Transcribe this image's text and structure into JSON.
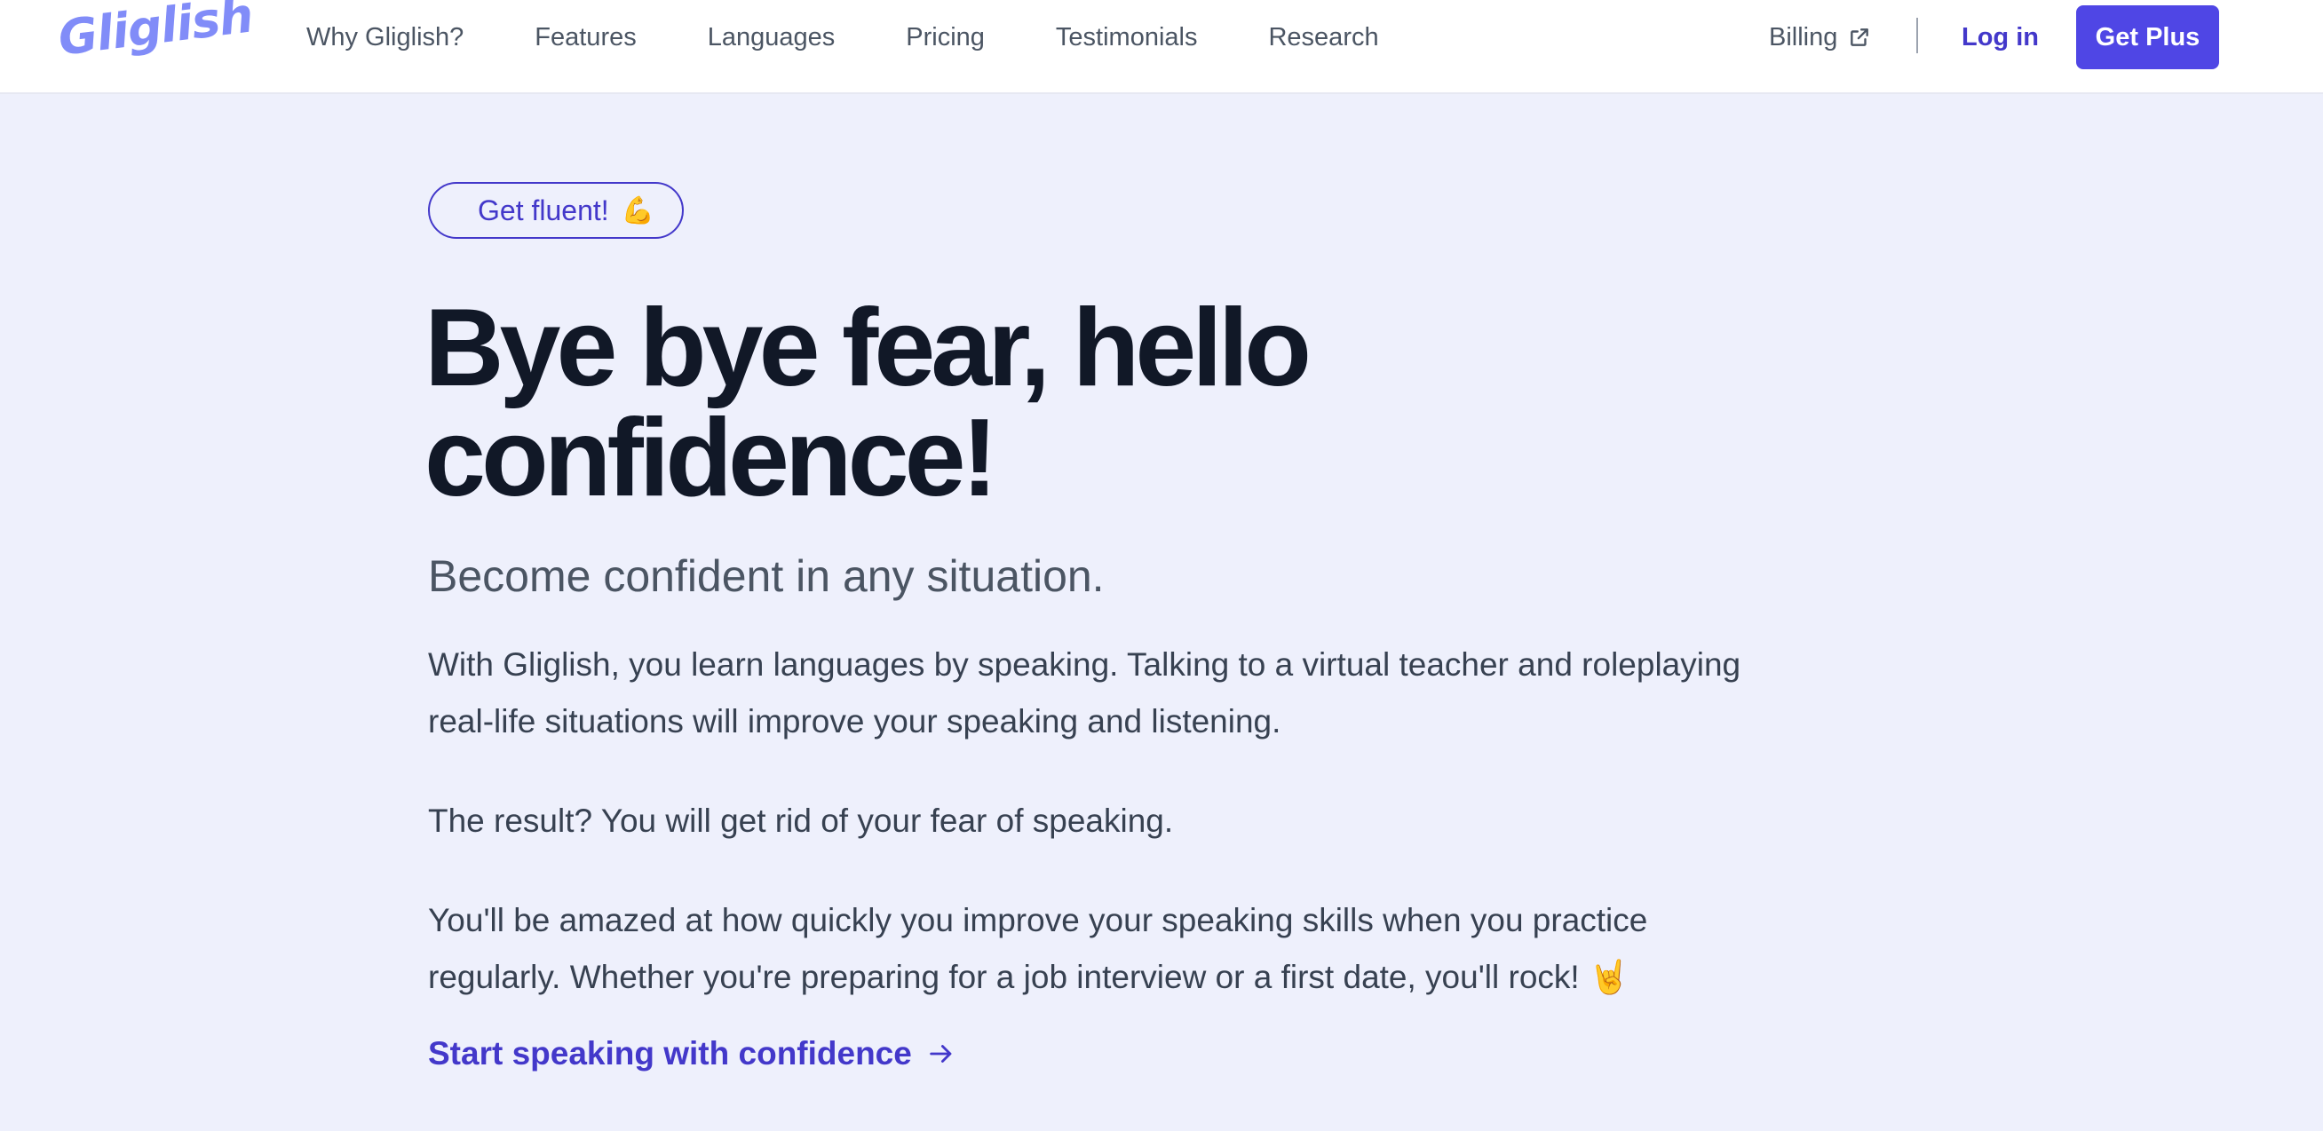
{
  "brand": {
    "logo_text": "Gliglish",
    "accent": "#4f46e5",
    "logo_color": "#818cf8",
    "background": "#eef0fc"
  },
  "nav": {
    "links": [
      "Why Gliglish?",
      "Features",
      "Languages",
      "Pricing",
      "Testimonials",
      "Research"
    ],
    "billing_label": "Billing",
    "billing_icon": "external-link-icon",
    "login_label": "Log in",
    "cta_label": "Get Plus"
  },
  "hero": {
    "pill_label": "Get fluent!",
    "pill_emoji": "💪",
    "headline_line1": "Bye bye fear, hello",
    "headline_line2": "confidence!",
    "subtitle": "Become confident in any situation.",
    "paragraph1": "With Gliglish, you learn languages by speaking. Talking to a virtual teacher and roleplaying real-life situations will improve your speaking and listening.",
    "paragraph2": "The result? You will get rid of your fear of speaking.",
    "paragraph3": "You'll be amazed at how quickly you improve your speaking skills when you practice regularly. Whether you're preparing for a job interview or a first date, you'll rock! 🤘",
    "cta_label": "Start speaking with confidence",
    "cta_icon": "arrow-right-icon"
  }
}
